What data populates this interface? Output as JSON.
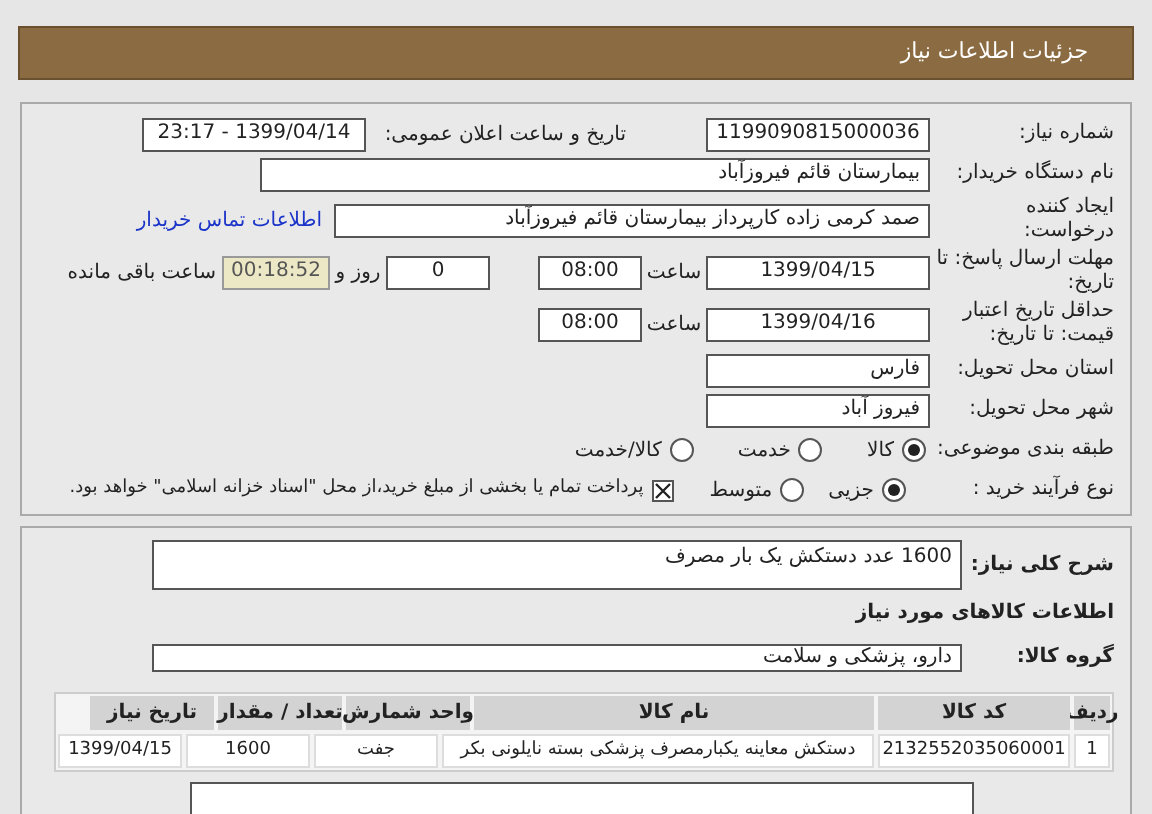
{
  "header": {
    "title": "جزئیات اطلاعات نیاز"
  },
  "need_number": {
    "label": "شماره نیاز:",
    "value": "1199090815000036"
  },
  "announce": {
    "label": "تاریخ و ساعت اعلان عمومی:",
    "value": "1399/04/14 - 23:17"
  },
  "buyer": {
    "label": "نام دستگاه خریدار:",
    "value": "بیمارستان قائم فیروزآباد"
  },
  "creator": {
    "label": "ایجاد کننده درخواست:",
    "value": "صمد کرمی زاده کارپرداز بیمارستان قائم فیروزآباد",
    "link": "اطلاعات تماس خریدار"
  },
  "deadline": {
    "label": "مهلت ارسال پاسخ: تا تاریخ:",
    "date": "1399/04/15",
    "time_label": "ساعت",
    "time": "08:00",
    "days": "0",
    "days_label": "روز و",
    "remaining": "00:18:52",
    "remaining_label": "ساعت باقی مانده"
  },
  "validity": {
    "label": "حداقل تاریخ اعتبار قیمت: تا تاریخ:",
    "date": "1399/04/16",
    "time_label": "ساعت",
    "time": "08:00"
  },
  "province": {
    "label": "استان محل تحویل:",
    "value": "فارس"
  },
  "city": {
    "label": "شهر محل تحویل:",
    "value": "فیروز آباد"
  },
  "category": {
    "label": "طبقه بندی موضوعی:",
    "options": [
      {
        "label": "کالا",
        "selected": true
      },
      {
        "label": "خدمت",
        "selected": false
      },
      {
        "label": "کالا/خدمت",
        "selected": false
      }
    ]
  },
  "process": {
    "label": "نوع فرآیند خرید :",
    "options": [
      {
        "label": "جزیی",
        "selected": true
      },
      {
        "label": "متوسط",
        "selected": false
      }
    ],
    "treasury": {
      "label": "پرداخت تمام یا بخشی از مبلغ خرید،از محل \"اسناد خزانه اسلامی\" خواهد بود.",
      "checked": true
    }
  },
  "description": {
    "label": "شرح کلی نیاز:",
    "value": "1600 عدد دستکش یک بار مصرف"
  },
  "goods_heading": "اطلاعات کالاهای مورد نیاز",
  "goods_group": {
    "label": "گروه کالا:",
    "value": "دارو، پزشکی و سلامت"
  },
  "table": {
    "columns": [
      "ردیف",
      "کد کالا",
      "نام کالا",
      "واحد شمارش",
      "تعداد / مقدار",
      "تاریخ نیاز"
    ],
    "rows": [
      [
        "1",
        "2132552035060001",
        "دستکش معاینه یکبارمصرف پزشکی بسته نایلونی بکر",
        "جفت",
        "1600",
        "1399/04/15"
      ]
    ]
  }
}
